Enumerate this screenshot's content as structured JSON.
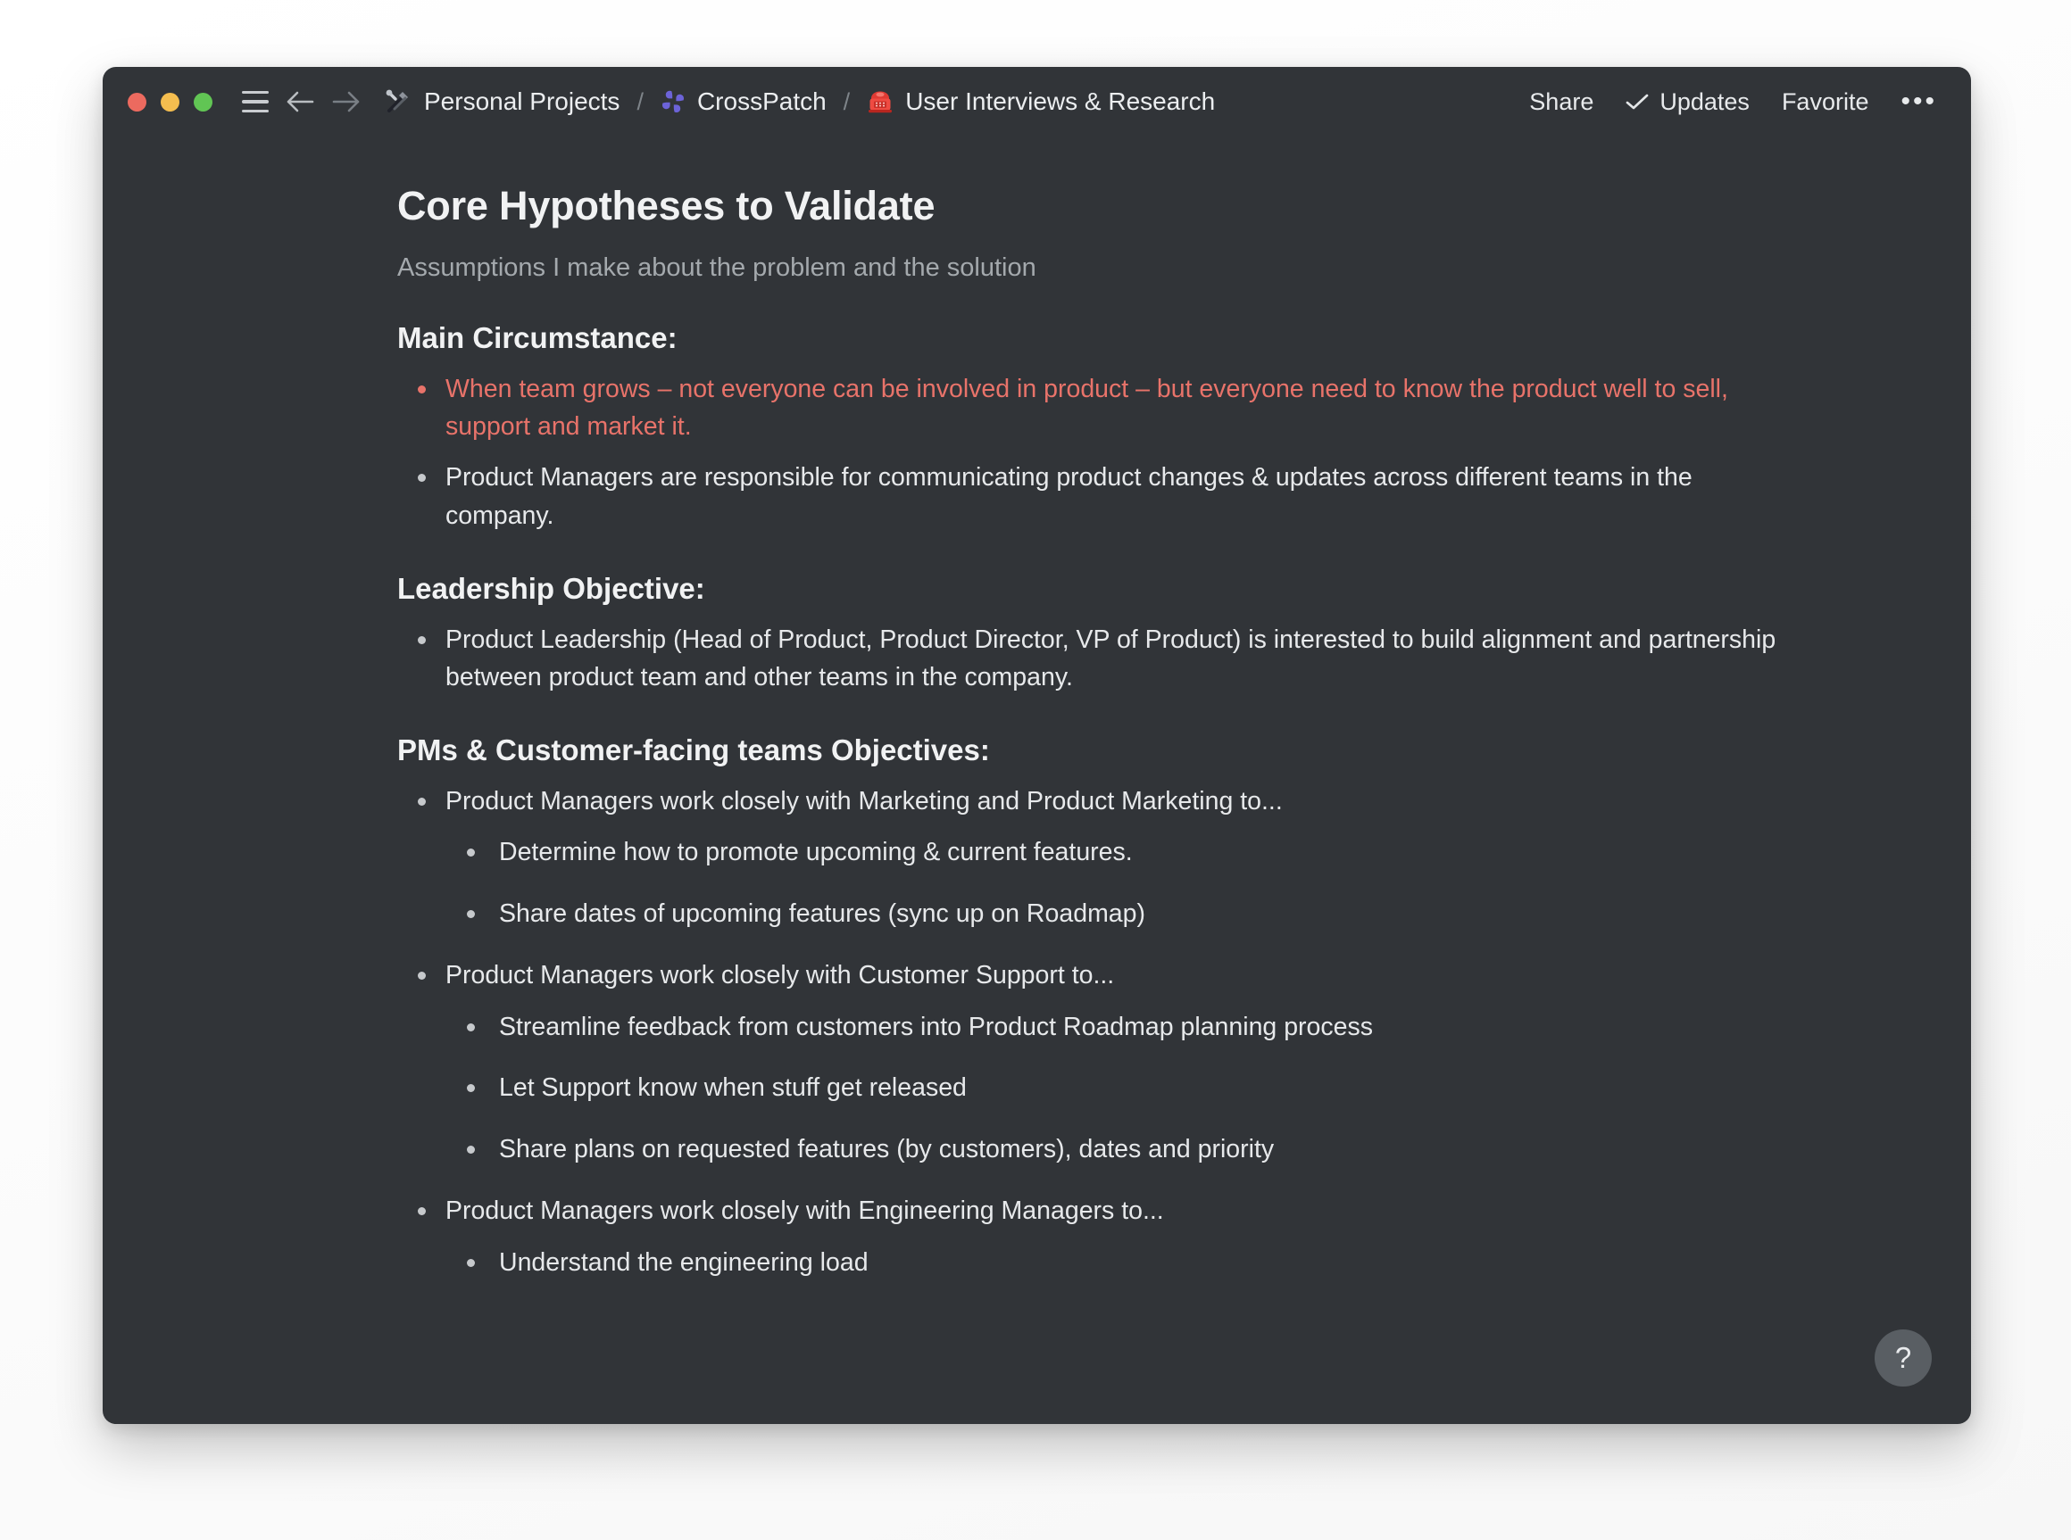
{
  "window": {
    "traffic_lights": [
      "close",
      "minimize",
      "maximize"
    ],
    "colors": {
      "window_bg": "#313438",
      "accent_red": "#e8736a",
      "text_primary": "#e9ebed",
      "text_muted": "#a4a9ad",
      "clover_purple": "#6c63d8",
      "desktop_bg": "#fcfcfc"
    }
  },
  "titlebar": {
    "menu_label": "menu",
    "back_label": "back",
    "forward_label": "forward",
    "breadcrumb": [
      {
        "icon": "wrench-hammer-icon",
        "label": "Personal Projects"
      },
      {
        "icon": "clover-icon",
        "label": "CrossPatch"
      },
      {
        "icon": "telephone-icon",
        "label": "User Interviews & Research"
      }
    ],
    "separator": "/",
    "actions": {
      "share": "Share",
      "updates": "Updates",
      "favorite": "Favorite",
      "more": "•••"
    }
  },
  "document": {
    "title": "Core Hypotheses to Validate",
    "subtitle": "Assumptions I make about the problem and the solution",
    "sections": [
      {
        "heading": "Main Circumstance:",
        "bullets": [
          {
            "text": "When team grows – not everyone can be involved in product – but everyone need to know the product well to sell, support and market it.",
            "accent": true
          },
          {
            "text": "Product Managers are responsible for communicating product changes & updates across different teams in the company.",
            "accent": false
          }
        ]
      },
      {
        "heading": "Leadership Objective:",
        "bullets": [
          {
            "text": "Product Leadership (Head of Product, Product Director, VP of Product) is interested to build alignment and partnership between product team and other teams in the company.",
            "accent": false
          }
        ]
      },
      {
        "heading": "PMs & Customer-facing teams Objectives:",
        "bullets": [
          {
            "text": "Product Managers work closely with Marketing and Product Marketing to...",
            "accent": false,
            "children": [
              "Determine how to promote upcoming & current features.",
              "Share dates of upcoming features (sync up on Roadmap)"
            ]
          },
          {
            "text": "Product Managers work closely with Customer Support to...",
            "accent": false,
            "children": [
              "Streamline feedback from customers into Product Roadmap planning process",
              "Let Support know when stuff get released",
              "Share plans on requested features (by customers), dates and priority"
            ]
          },
          {
            "text": "Product Managers work closely with Engineering Managers to...",
            "accent": false,
            "children": [
              "Understand the engineering load"
            ]
          }
        ]
      }
    ]
  },
  "help": {
    "label": "?"
  }
}
